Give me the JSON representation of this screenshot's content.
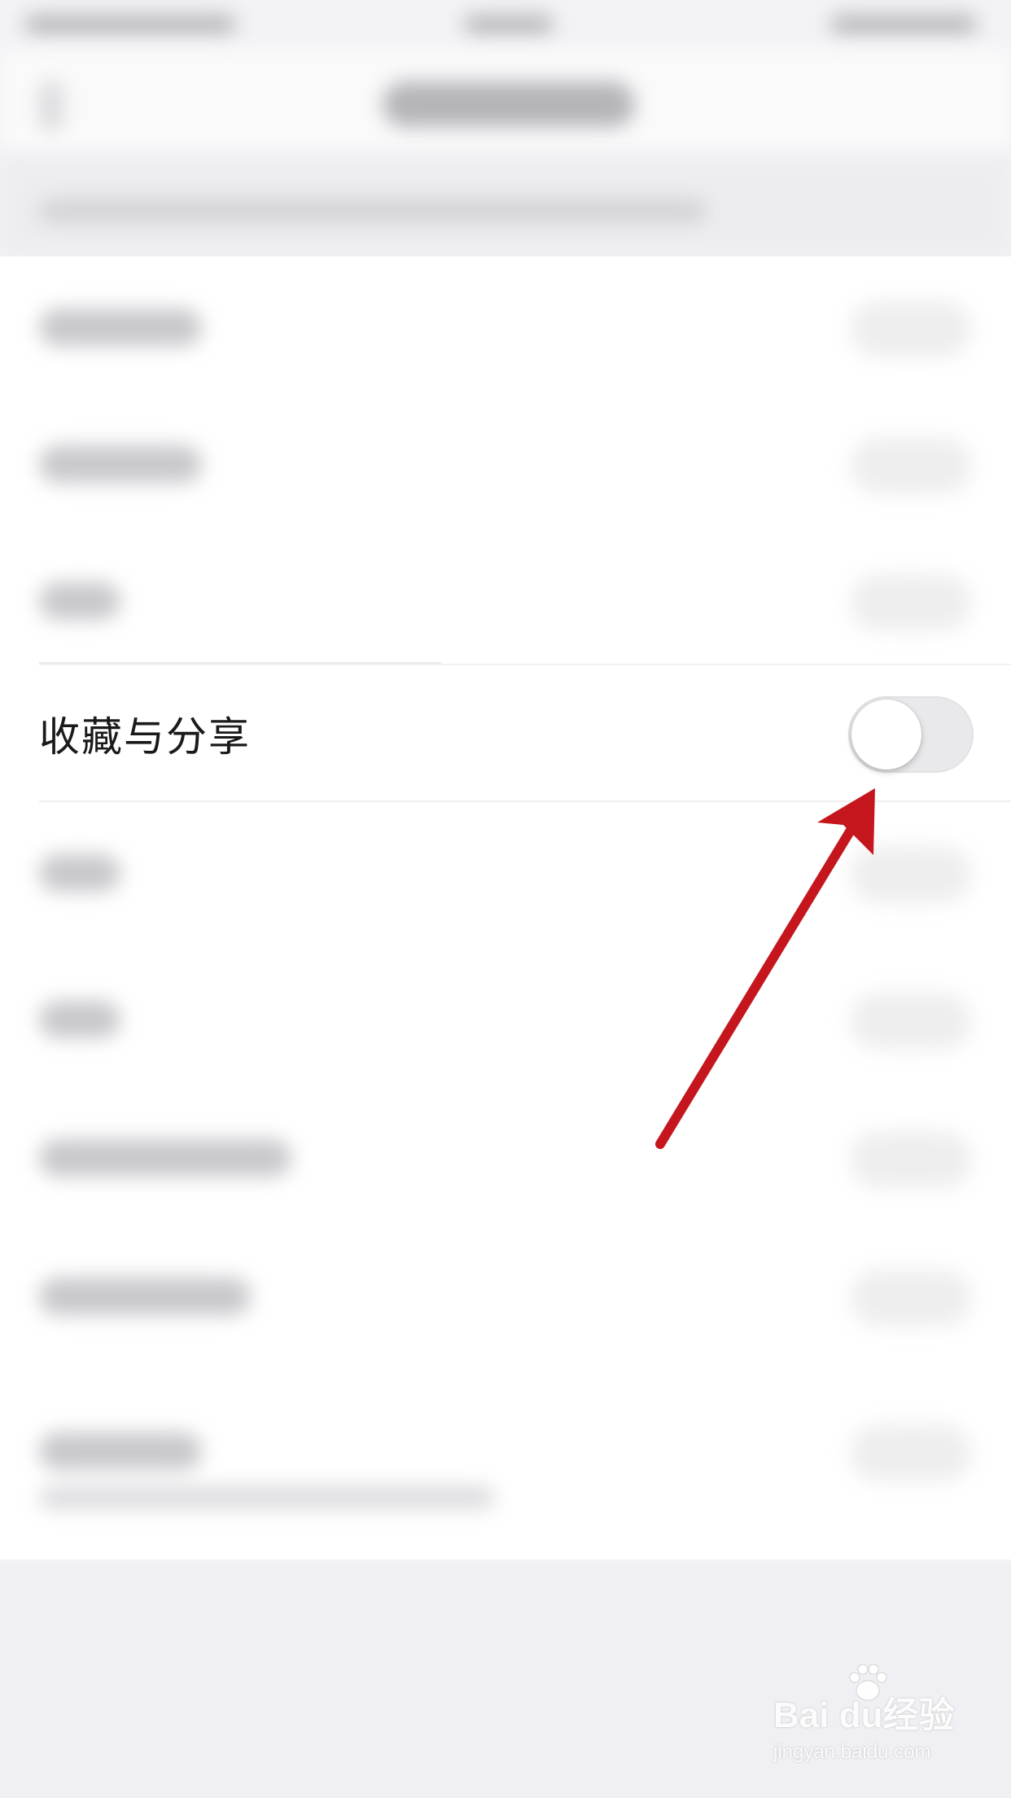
{
  "row": {
    "label": "收藏与分享",
    "toggle_on": false
  },
  "annotation": {
    "arrow_color": "#c4161c"
  },
  "watermark": {
    "brand": "Bai du经验",
    "url": "jingyan.baidu.com"
  },
  "colors": {
    "background": "#f3f3f6",
    "list_background": "#ffffff",
    "toggle_off_track": "#e9e9eb",
    "text": "#1a1a1a"
  }
}
